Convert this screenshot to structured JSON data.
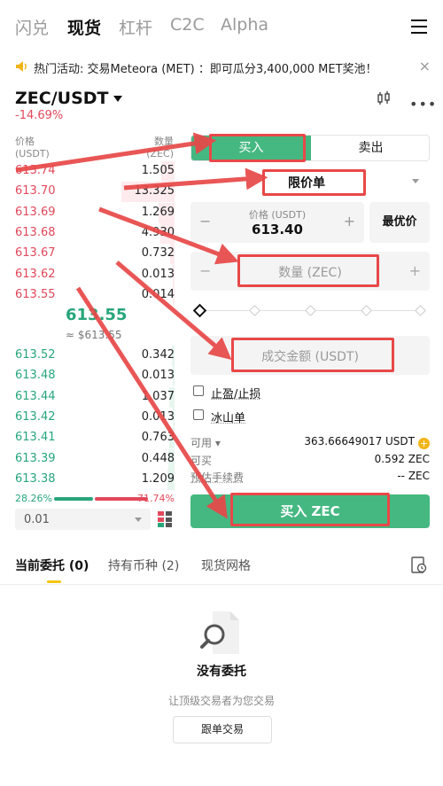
{
  "nav": {
    "tabs": [
      "闪兑",
      "现货",
      "杠杆",
      "C2C",
      "Alpha"
    ],
    "active_index": 1
  },
  "banner": {
    "text": "热门活动: 交易Meteora (MET) ：即可瓜分3,400,000 MET奖池！",
    "close": "×"
  },
  "pair": {
    "symbol": "ZEC/USDT",
    "change": "-14.69%"
  },
  "orderbook": {
    "price_header": "价格",
    "price_unit": "(USDT)",
    "qty_header": "数量",
    "qty_unit": "(ZEC)",
    "asks": [
      {
        "price": "613.74",
        "qty": "1.505",
        "depth": 0.25
      },
      {
        "price": "613.70",
        "qty": "13.325",
        "depth": 1.0
      },
      {
        "price": "613.69",
        "qty": "1.269",
        "depth": 0.3
      },
      {
        "price": "613.68",
        "qty": "4.930",
        "depth": 0.27
      },
      {
        "price": "613.67",
        "qty": "0.732",
        "depth": 0.08
      },
      {
        "price": "613.62",
        "qty": "0.013",
        "depth": 0.04
      },
      {
        "price": "613.55",
        "qty": "0.014",
        "depth": 0.04
      }
    ],
    "mid_price": "613.55",
    "mid_usd": "≈ $613.55",
    "bids": [
      {
        "price": "613.52",
        "qty": "0.342",
        "depth": 0.05
      },
      {
        "price": "613.48",
        "qty": "0.013",
        "depth": 0.03
      },
      {
        "price": "613.44",
        "qty": "1.037",
        "depth": 0.1
      },
      {
        "price": "613.42",
        "qty": "0.013",
        "depth": 0.03
      },
      {
        "price": "613.41",
        "qty": "0.763",
        "depth": 0.1
      },
      {
        "price": "613.39",
        "qty": "0.448",
        "depth": 0.12
      },
      {
        "price": "613.38",
        "qty": "1.209",
        "depth": 0.14
      }
    ],
    "buy_ratio": "28.26%",
    "sell_ratio": "71.74%",
    "precision": "0.01"
  },
  "form": {
    "buy_tab": "买入",
    "sell_tab": "卖出",
    "order_type": "限价单",
    "price_label": "价格 (USDT)",
    "price_value": "613.40",
    "best_price": "最优价",
    "qty_placeholder": "数量 (ZEC)",
    "amount_placeholder": "成交金额 (USDT)",
    "tpsl": "止盈/止损",
    "iceberg": "冰山单",
    "available_label": "可用",
    "available_value": "363.66649017 USDT",
    "can_buy_label": "可买",
    "can_buy_value": "0.592 ZEC",
    "fee_label": "预估手续费",
    "fee_value": "-- ZEC",
    "submit": "买入 ZEC",
    "minus": "−",
    "plus": "+"
  },
  "bottom_tabs": {
    "open_orders": "当前委托 (0)",
    "holdings": "持有币种 (2)",
    "grid": "现货网格"
  },
  "empty": {
    "title": "没有委托",
    "subtitle": "让顶级交易者为您交易",
    "button": "跟单交易"
  },
  "colors": {
    "green": "#45b882",
    "red": "#e2485a",
    "annotation": "#e84848",
    "accent_yellow": "#f2c511"
  }
}
